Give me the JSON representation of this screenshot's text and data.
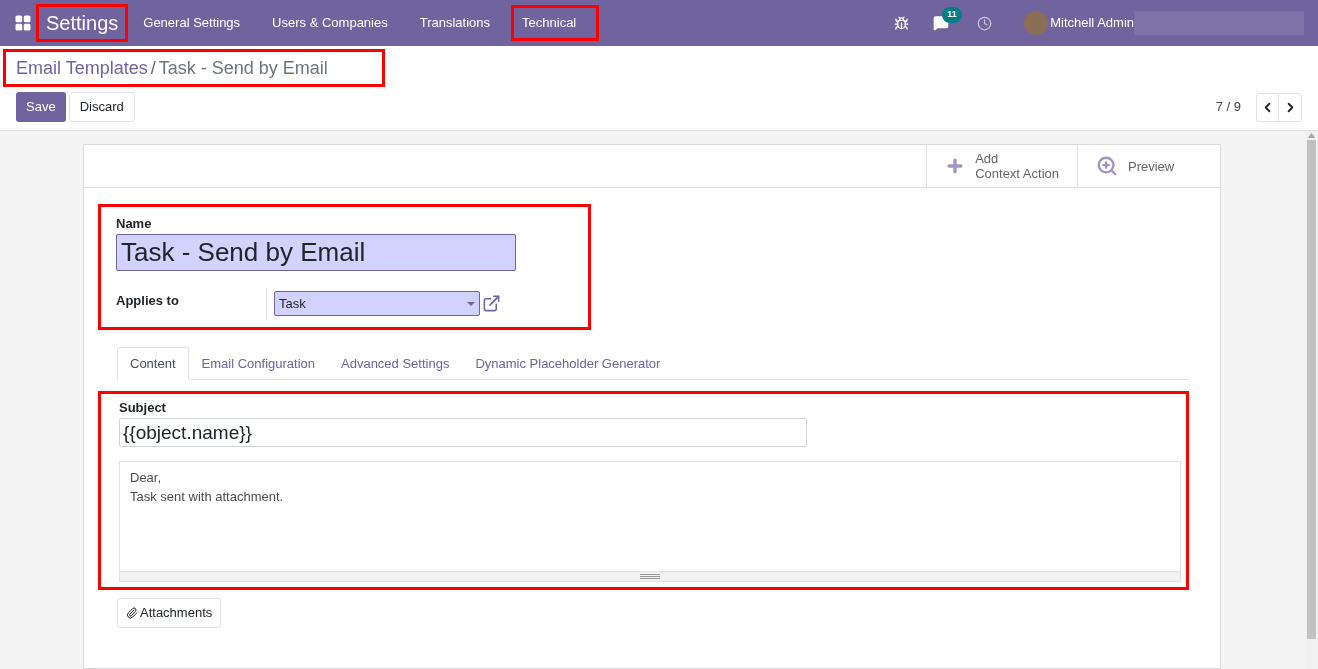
{
  "navbar": {
    "app_title": {
      "text": "Settings",
      "highlighted": true
    },
    "menu": [
      {
        "label": "General Settings",
        "highlighted": false
      },
      {
        "label": "Users & Companies",
        "highlighted": false
      },
      {
        "label": "Translations",
        "highlighted": false
      },
      {
        "label": "Technical",
        "highlighted": true
      }
    ],
    "messages_badge": "11",
    "user_name": "Mitchell Admin"
  },
  "breadcrumb": {
    "highlighted": true,
    "parent": "Email Templates",
    "separator": "/",
    "current": "Task - Send by Email"
  },
  "buttons": {
    "save": "Save",
    "discard": "Discard"
  },
  "pager": {
    "text": "7 / 9"
  },
  "sheet_buttons": [
    {
      "kind": "add",
      "label_lines": [
        "Add",
        "Context Action"
      ]
    },
    {
      "kind": "preview",
      "label_lines": [
        "Preview"
      ]
    }
  ],
  "name_section": {
    "highlighted": true,
    "name_label": "Name",
    "name_value": "Task - Send by Email",
    "applies_label": "Applies to",
    "applies_value": "Task"
  },
  "tabs": [
    {
      "label": "Content",
      "selected": true
    },
    {
      "label": "Email Configuration",
      "selected": false
    },
    {
      "label": "Advanced Settings",
      "selected": false
    },
    {
      "label": "Dynamic Placeholder Generator",
      "selected": false
    }
  ],
  "content_section": {
    "highlighted": true,
    "subject_label": "Subject",
    "subject_value": "{{object.name}}",
    "body_lines": [
      "Dear,",
      "Task sent with attachment."
    ]
  },
  "attachments_button": "Attachments"
}
